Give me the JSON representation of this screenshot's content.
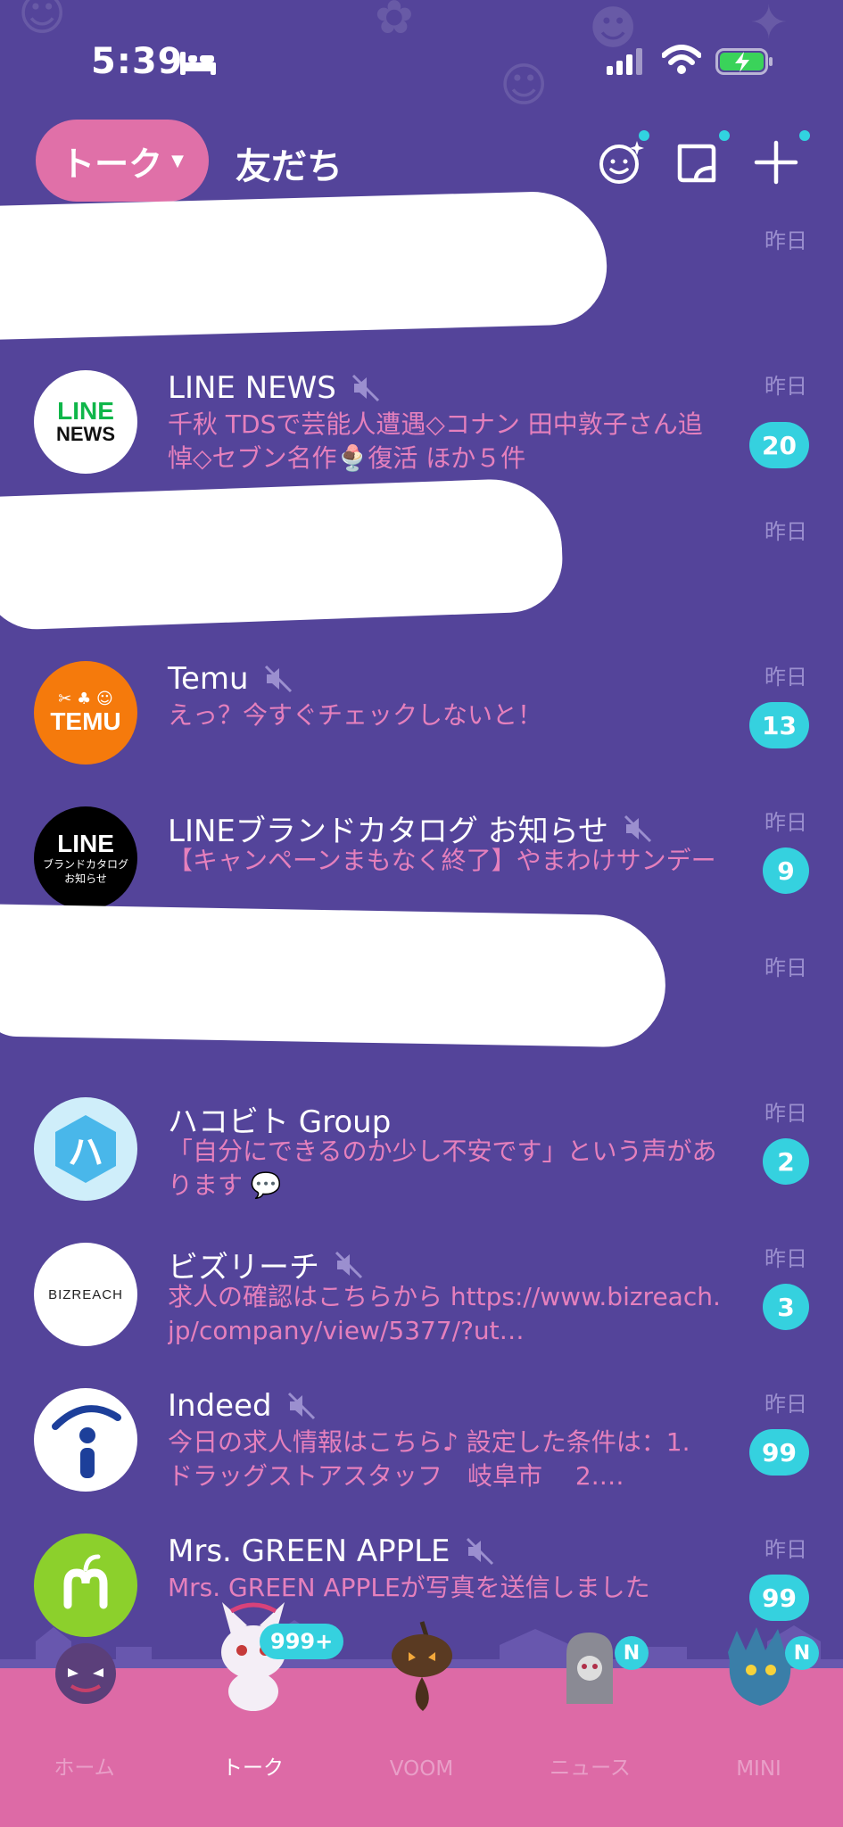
{
  "status_bar": {
    "time": "5:39"
  },
  "header": {
    "tab_talk": "トーク",
    "tab_friends": "友だち"
  },
  "chats": [
    {
      "name": "",
      "preview": "",
      "date": "昨日",
      "badge": "",
      "redacted": true
    },
    {
      "name": "LINE NEWS",
      "preview": "千秋 TDSで芸能人遭遇◇コナン 田中敦子さん追悼◇セブン名作🍨復活 ほか５件",
      "date": "昨日",
      "badge": "20",
      "muted": true
    },
    {
      "name": "",
      "preview": "",
      "date": "昨日",
      "badge": "",
      "redacted": true
    },
    {
      "name": "Temu",
      "preview": "えっ？今すぐチェックしないと！",
      "date": "昨日",
      "badge": "13",
      "muted": true
    },
    {
      "name": "LINEブランドカタログ お知らせ",
      "preview": "【キャンペーンまもなく終了】やまわけサンデー",
      "date": "昨日",
      "badge": "9",
      "muted": true
    },
    {
      "name": "",
      "preview": "",
      "date": "昨日",
      "badge": "",
      "redacted": true
    },
    {
      "name": "ハコビト Group",
      "preview": "「自分にできるのか少し不安です」という声があります 💬",
      "date": "昨日",
      "badge": "2",
      "muted": false
    },
    {
      "name": "ビズリーチ",
      "preview": "求人の確認はこちらから https://www.bizreach.jp/company/view/5377/?ut…",
      "date": "昨日",
      "badge": "3",
      "muted": true
    },
    {
      "name": "Indeed",
      "preview": "今日の求人情報はこちら♪ 設定した条件は：1. ドラッグストアスタッフ　岐阜市　 2.…",
      "date": "昨日",
      "badge": "99",
      "muted": true
    },
    {
      "name": "Mrs. GREEN APPLE",
      "preview": "Mrs. GREEN APPLEが写真を送信しました",
      "date": "昨日",
      "badge": "99",
      "muted": true
    }
  ],
  "avatars": {
    "line_news_top": "LINE",
    "line_news_bottom": "NEWS",
    "temu": "TEMU",
    "brand_top": "LINE",
    "brand_line2": "ブランドカタログ",
    "brand_line3": "お知らせ",
    "hakobito": "ハ",
    "bizreach": "BIZREACH"
  },
  "tabbar": {
    "items": [
      {
        "label": "ホーム",
        "active": false,
        "badge": ""
      },
      {
        "label": "トーク",
        "active": true,
        "badge": "999+"
      },
      {
        "label": "VOOM",
        "active": false,
        "badge": ""
      },
      {
        "label": "ニュース",
        "active": false,
        "badge": "N"
      },
      {
        "label": "MINI",
        "active": false,
        "badge": "N"
      }
    ]
  },
  "colors": {
    "background": "#54449a",
    "accent_pink": "#e070a8",
    "badge_cyan": "#35d1df",
    "preview_text": "#e580bd"
  }
}
